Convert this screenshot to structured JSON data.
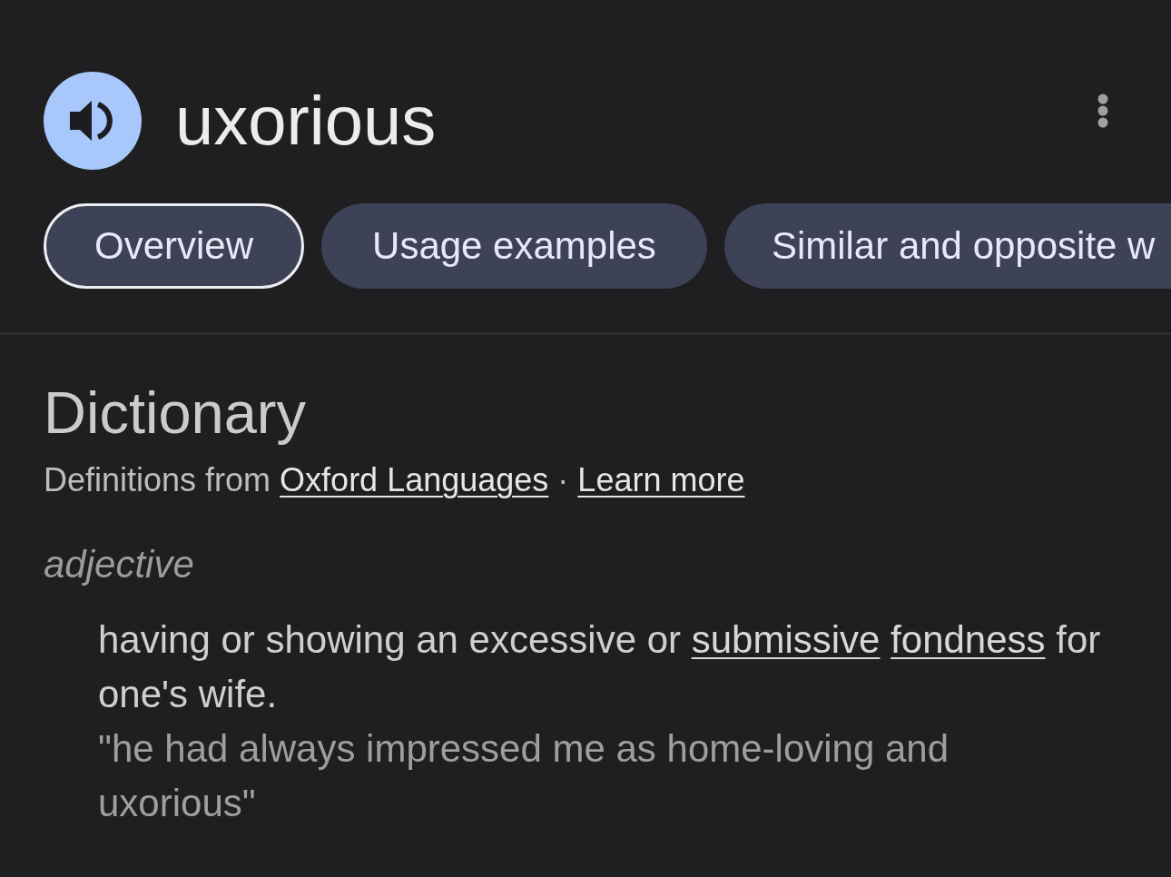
{
  "header": {
    "word": "uxorious"
  },
  "tabs": [
    {
      "label": "Overview",
      "selected": true
    },
    {
      "label": "Usage examples",
      "selected": false
    },
    {
      "label": "Similar and opposite w",
      "selected": false
    }
  ],
  "dictionary": {
    "title": "Dictionary",
    "source": [
      {
        "kind": "text",
        "text": "Definitions from"
      },
      {
        "kind": "link",
        "text": "Oxford Languages"
      },
      {
        "kind": "text",
        "text": "·"
      },
      {
        "kind": "link",
        "text": "Learn more"
      }
    ],
    "entries": [
      {
        "part_of_speech": "adjective",
        "senses": [
          {
            "definition": [
              {
                "kind": "text",
                "text": "having or showing an excessive or"
              },
              {
                "kind": "link",
                "text": "submissive"
              },
              {
                "kind": "link",
                "text": "fondness"
              },
              {
                "kind": "text",
                "text": "for one's wife."
              }
            ],
            "example": "\"he had always impressed me as home-loving and uxorious\""
          }
        ]
      }
    ]
  }
}
